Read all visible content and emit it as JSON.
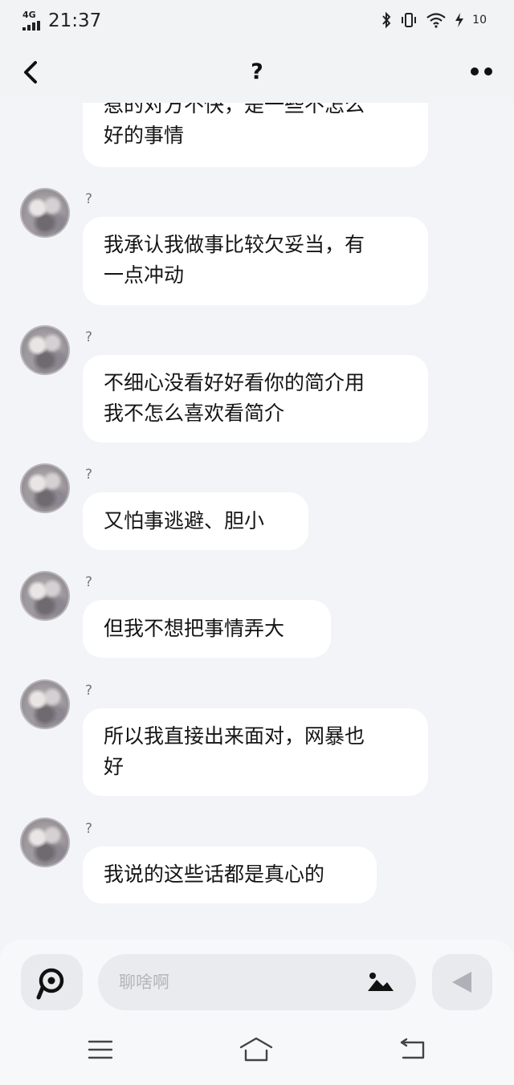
{
  "status_bar": {
    "network": "4G",
    "time": "21:37",
    "battery": "10"
  },
  "header": {
    "title": "?"
  },
  "messages": [
    {
      "sender": "",
      "text_lines": [
        "惹的对方不快，是一些不怎么",
        "好的事情"
      ]
    },
    {
      "sender": "?",
      "text_lines": [
        "我承认我做事比较欠妥当，有",
        "一点冲动"
      ]
    },
    {
      "sender": "?",
      "text_lines": [
        "不细心没看好好看你的简介用",
        "我不怎么喜欢看简介"
      ]
    },
    {
      "sender": "?",
      "text_lines": [
        "又怕事逃避、胆小"
      ]
    },
    {
      "sender": "?",
      "text_lines": [
        "但我不想把事情弄大"
      ]
    },
    {
      "sender": "?",
      "text_lines": [
        "所以我直接出来面对，网暴也",
        "好"
      ]
    },
    {
      "sender": "?",
      "text_lines": [
        "我说的这些话都是真心的"
      ]
    }
  ],
  "input": {
    "placeholder": "聊啥啊"
  },
  "icons": {
    "back": "chevron-left-icon",
    "more": "more-dots-icon",
    "voice": "voice-icon",
    "image": "image-icon",
    "send": "send-icon",
    "menu": "menu-icon",
    "home": "home-icon",
    "recent": "back-nav-icon"
  },
  "colors": {
    "background": "#f2f4f8",
    "bubble": "#ffffff",
    "control_bg": "#e9eaee"
  }
}
